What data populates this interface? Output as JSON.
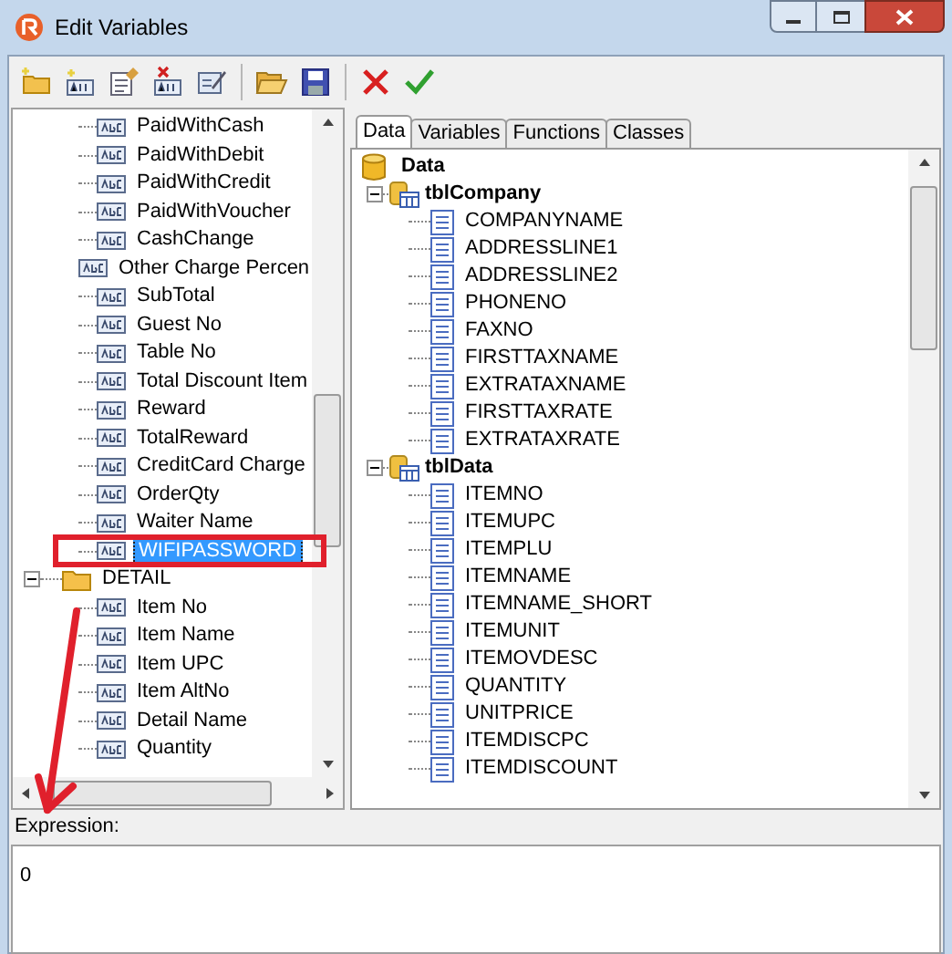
{
  "window": {
    "title": "Edit Variables"
  },
  "left_tree": [
    {
      "kind": "field",
      "label": "PaidWithCash",
      "selected": false
    },
    {
      "kind": "field",
      "label": "PaidWithDebit",
      "selected": false
    },
    {
      "kind": "field",
      "label": "PaidWithCredit",
      "selected": false
    },
    {
      "kind": "field",
      "label": "PaidWithVoucher",
      "selected": false
    },
    {
      "kind": "field",
      "label": "CashChange",
      "selected": false
    },
    {
      "kind": "field",
      "label": "Other Charge Percen",
      "selected": false
    },
    {
      "kind": "field",
      "label": "SubTotal",
      "selected": false
    },
    {
      "kind": "field",
      "label": "Guest No",
      "selected": false
    },
    {
      "kind": "field",
      "label": "Table No",
      "selected": false
    },
    {
      "kind": "field",
      "label": "Total Discount Item",
      "selected": false
    },
    {
      "kind": "field",
      "label": "Reward",
      "selected": false
    },
    {
      "kind": "field",
      "label": "TotalReward",
      "selected": false
    },
    {
      "kind": "field",
      "label": "CreditCard Charge",
      "selected": false
    },
    {
      "kind": "field",
      "label": "OrderQty",
      "selected": false
    },
    {
      "kind": "field",
      "label": "Waiter Name",
      "selected": false
    },
    {
      "kind": "field",
      "label": "WIFIPASSWORD",
      "selected": true,
      "highlighted": true
    },
    {
      "kind": "folder",
      "label": "DETAIL",
      "selected": false,
      "expanded": true,
      "children": [
        {
          "kind": "field",
          "label": "Item No",
          "selected": false
        },
        {
          "kind": "field",
          "label": "Item Name",
          "selected": false
        },
        {
          "kind": "field",
          "label": "Item UPC",
          "selected": false
        },
        {
          "kind": "field",
          "label": "Item AltNo",
          "selected": false
        },
        {
          "kind": "field",
          "label": "Detail Name",
          "selected": false
        },
        {
          "kind": "field",
          "label": "Quantity",
          "selected": false
        }
      ]
    }
  ],
  "tabs": [
    {
      "label": "Data",
      "selected": true
    },
    {
      "label": "Variables",
      "selected": false
    },
    {
      "label": "Functions",
      "selected": false
    },
    {
      "label": "Classes",
      "selected": false
    }
  ],
  "data_tree": {
    "label": "Data",
    "children": [
      {
        "label": "tblCompany",
        "expanded": true,
        "children": [
          "COMPANYNAME",
          "ADDRESSLINE1",
          "ADDRESSLINE2",
          "PHONENO",
          "FAXNO",
          "FIRSTTAXNAME",
          "EXTRATAXNAME",
          "FIRSTTAXRATE",
          "EXTRATAXRATE"
        ]
      },
      {
        "label": "tblData",
        "expanded": true,
        "children": [
          "ITEMNO",
          "ITEMUPC",
          "ITEMPLU",
          "ITEMNAME",
          "ITEMNAME_SHORT",
          "ITEMUNIT",
          "ITEMOVDESC",
          "QUANTITY",
          "UNITPRICE",
          "ITEMDISCPC",
          "ITEMDISCOUNT"
        ]
      }
    ]
  },
  "expression": {
    "label": "Expression:",
    "value": "0"
  }
}
